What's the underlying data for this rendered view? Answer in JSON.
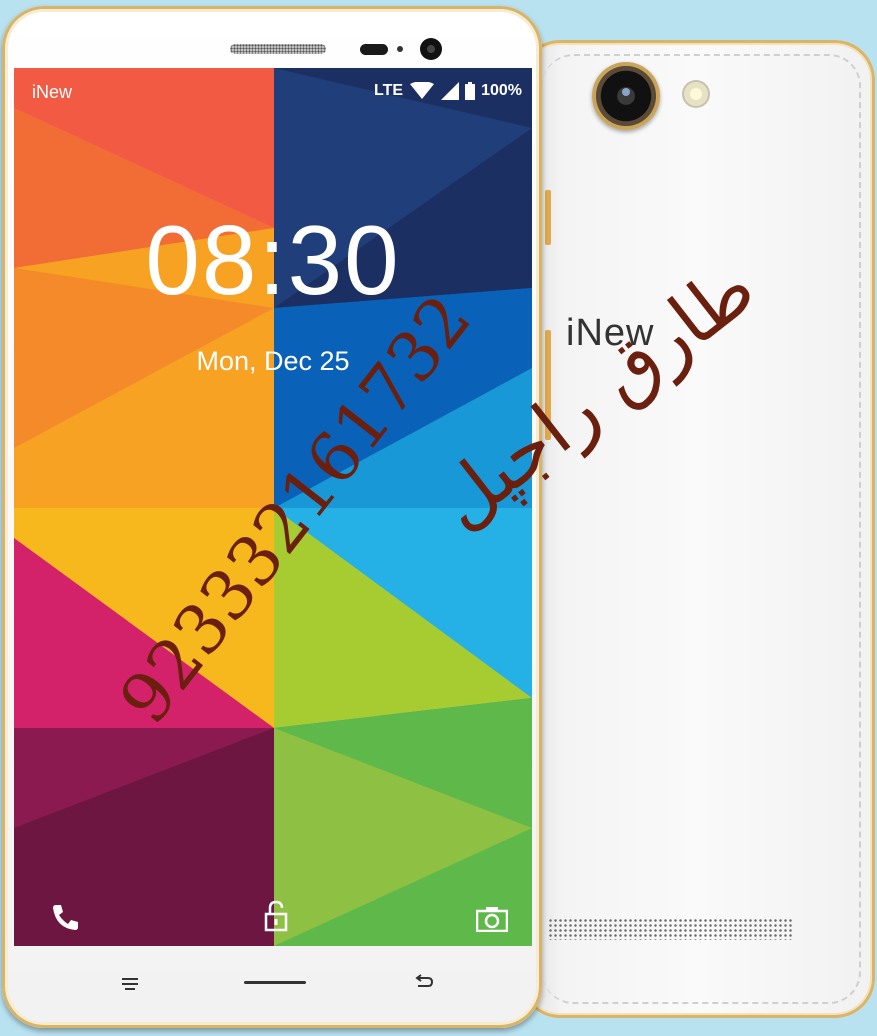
{
  "brand": "iNew",
  "status_bar": {
    "network": "LTE",
    "battery": "100%"
  },
  "lockscreen": {
    "time": "08:30",
    "date": "Mon, Dec 25"
  },
  "back": {
    "logo": "iNew"
  },
  "watermark": {
    "phone": "923332161732",
    "name": "طارق راجپل"
  },
  "colors": {
    "frame_gold": "#d8b36a",
    "back_white": "#f4f4f4"
  },
  "icons": [
    "phone-icon",
    "lock-icon",
    "camera-icon",
    "menu-icon",
    "home-icon",
    "back-icon",
    "lte-icon",
    "wifi-icon",
    "signal-icon",
    "battery-icon"
  ]
}
